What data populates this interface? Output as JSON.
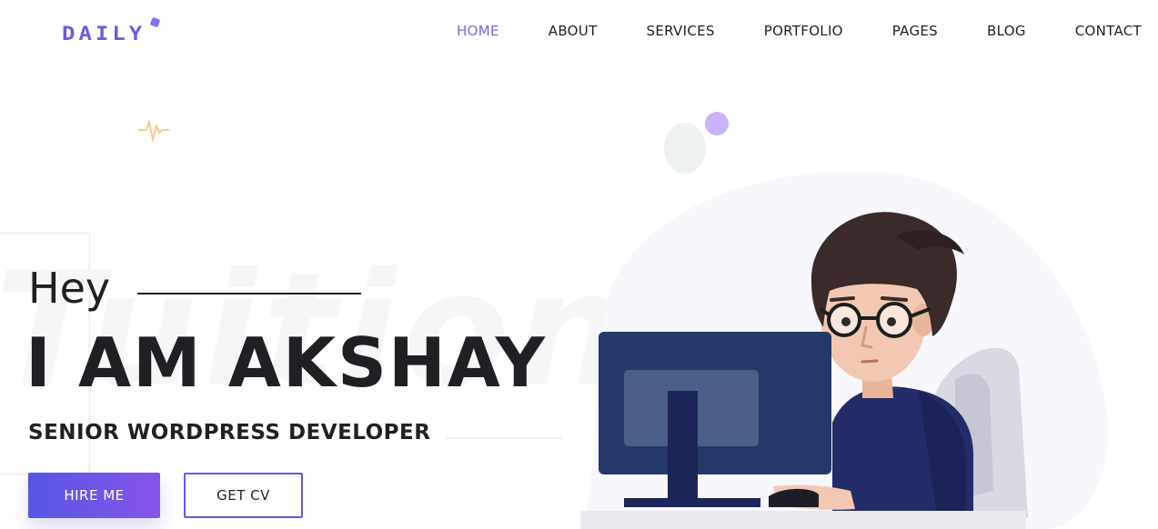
{
  "brand": {
    "logo_text": "DAILY",
    "accent": "#7a63e6"
  },
  "nav": {
    "items": [
      {
        "label": "HOME",
        "active": true
      },
      {
        "label": "ABOUT",
        "active": false
      },
      {
        "label": "SERVICES",
        "active": false
      },
      {
        "label": "PORTFOLIO",
        "active": false
      },
      {
        "label": "PAGES",
        "active": false
      },
      {
        "label": "BLOG",
        "active": false
      },
      {
        "label": "CONTACT",
        "active": false
      }
    ]
  },
  "hero": {
    "greeting": "Hey",
    "name": "I AM AKSHAY",
    "role": "SENIOR WORDPRESS DEVELOPER",
    "background_word": "Tuition",
    "primary_button": "HIRE ME",
    "secondary_button": "GET CV"
  },
  "icons": {
    "pulse": "heartbeat-pulse-icon",
    "illustration": "developer-at-computer-illustration"
  },
  "colors": {
    "button_gradient_start": "#5656e6",
    "button_gradient_end": "#8654e8",
    "text": "#1f2024",
    "blob": "#f7f7fc"
  }
}
